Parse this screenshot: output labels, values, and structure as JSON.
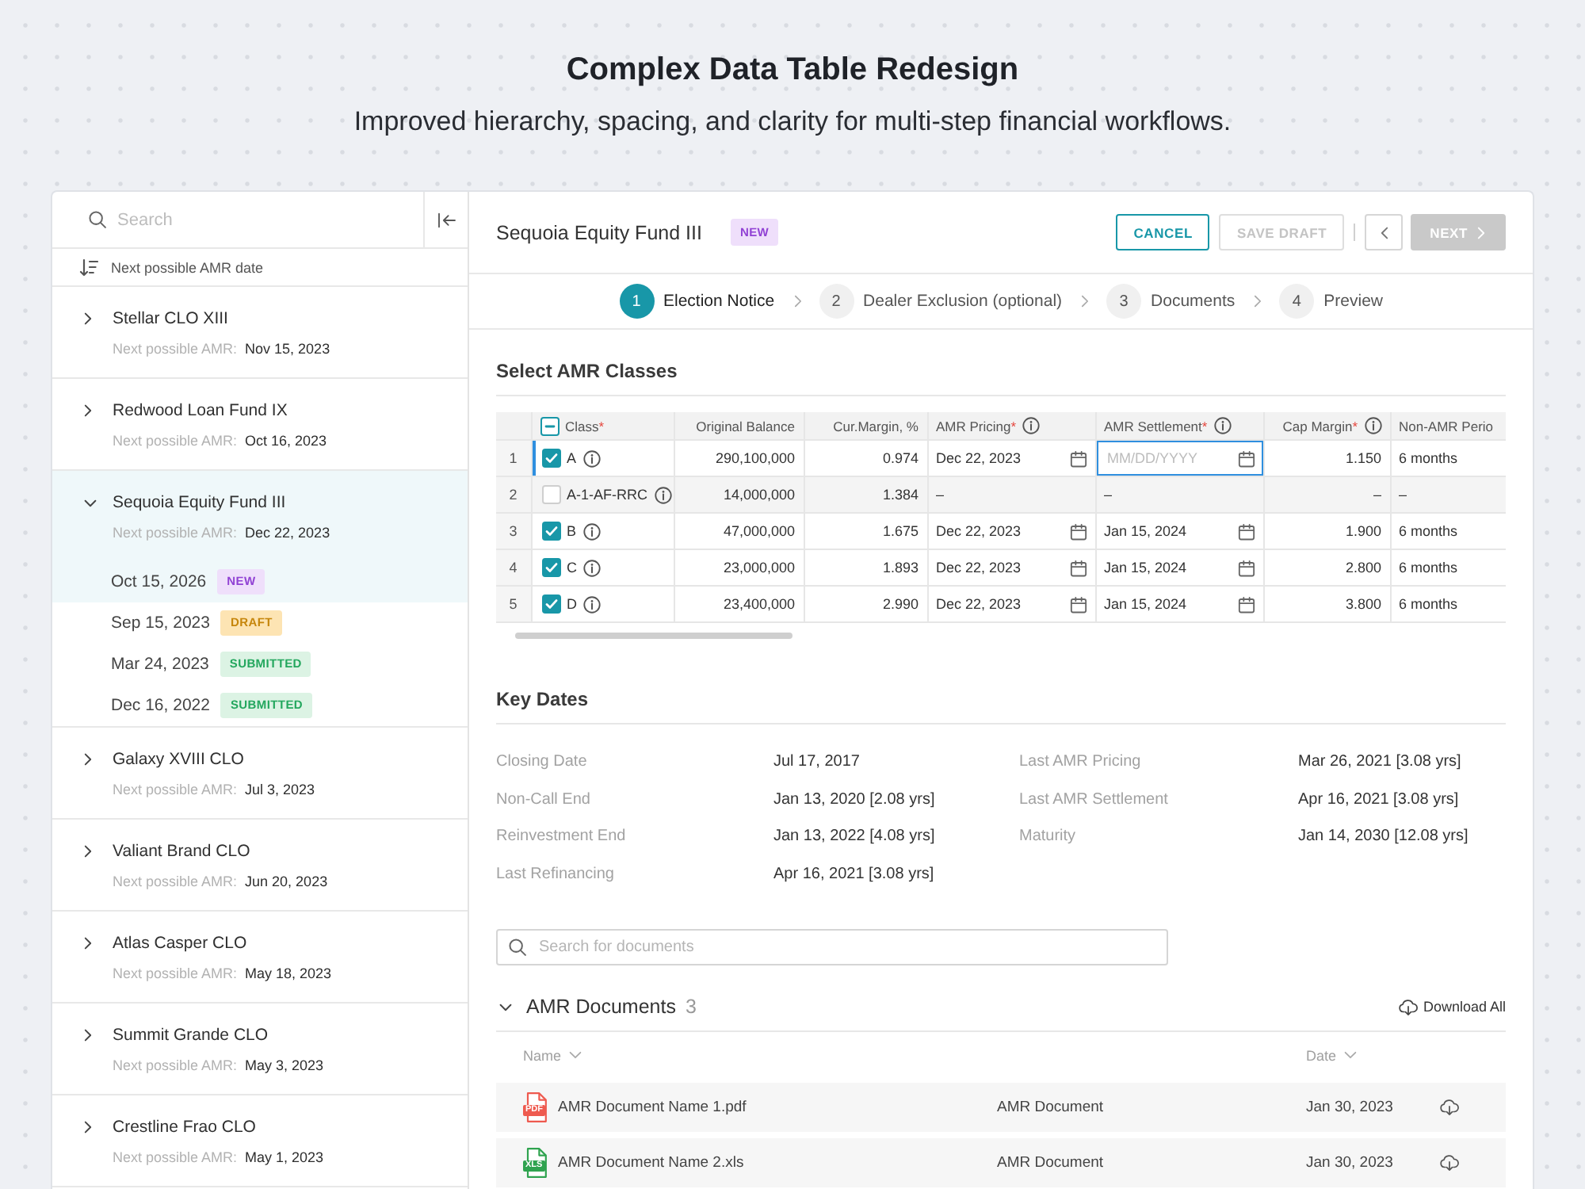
{
  "header": {
    "title": "Complex Data Table Redesign",
    "subtitle": "Improved hierarchy, spacing, and clarity for multi-step financial workflows."
  },
  "sidebar": {
    "search": {
      "placeholder": "Search"
    },
    "sort_label": "Next possible AMR date",
    "funds": [
      {
        "name": "Stellar CLO XIII",
        "next_label": "Next possible AMR:",
        "next_date": "Nov 15, 2023",
        "expanded": false,
        "selected": false
      },
      {
        "name": "Redwood Loan Fund IX",
        "next_label": "Next possible AMR:",
        "next_date": "Oct 16, 2023",
        "expanded": false,
        "selected": false
      },
      {
        "name": "Sequoia Equity Fund III",
        "next_label": "Next possible AMR:",
        "next_date": "Dec 22, 2023",
        "expanded": true,
        "selected": true,
        "versions": [
          {
            "date": "Oct 15, 2026",
            "status": "NEW",
            "kind": "new",
            "selected": true
          },
          {
            "date": "Sep 15, 2023",
            "status": "DRAFT",
            "kind": "draft",
            "selected": false
          },
          {
            "date": "Mar 24, 2023",
            "status": "SUBMITTED",
            "kind": "submitted",
            "selected": false
          },
          {
            "date": "Dec 16, 2022",
            "status": "SUBMITTED",
            "kind": "submitted",
            "selected": false
          }
        ]
      },
      {
        "name": "Galaxy XVIII CLO",
        "next_label": "Next possible AMR:",
        "next_date": "Jul 3, 2023",
        "expanded": false,
        "selected": false
      },
      {
        "name": "Valiant Brand CLO",
        "next_label": "Next possible AMR:",
        "next_date": "Jun 20, 2023",
        "expanded": false,
        "selected": false
      },
      {
        "name": "Atlas Casper CLO",
        "next_label": "Next possible AMR:",
        "next_date": "May 18, 2023",
        "expanded": false,
        "selected": false
      },
      {
        "name": "Summit Grande CLO",
        "next_label": "Next possible AMR:",
        "next_date": "May 3, 2023",
        "expanded": false,
        "selected": false
      },
      {
        "name": "Crestline Frao CLO",
        "next_label": "Next possible AMR:",
        "next_date": "May 1, 2023",
        "expanded": false,
        "selected": false
      }
    ]
  },
  "fund": {
    "title": "Sequoia Equity Fund III",
    "badge": {
      "label": "NEW",
      "kind": "new"
    },
    "actions": [
      {
        "kind": "cancel",
        "label": "CANCEL",
        "disabled": false
      },
      {
        "kind": "save",
        "label": "SAVE DRAFT",
        "disabled": true
      },
      {
        "kind": "back",
        "disabled": false
      },
      {
        "kind": "next",
        "label": "NEXT",
        "disabled": true
      }
    ],
    "steps": [
      {
        "number": "1",
        "label": "Election Notice",
        "selected": true
      },
      {
        "number": "2",
        "label": "Dealer Exclusion (optional)",
        "selected": false
      },
      {
        "number": "3",
        "label": "Documents",
        "selected": false
      },
      {
        "number": "4",
        "label": "Preview",
        "selected": false
      }
    ]
  },
  "classes": {
    "title": "Select AMR Classes",
    "select_all": {
      "checked": false,
      "partial": true
    },
    "columns": [
      {
        "label": "Class",
        "required_mark": "*",
        "info": false,
        "kind": "class"
      },
      {
        "label": "Original Balance",
        "info": false,
        "kind": "number"
      },
      {
        "label": "Cur.Margin, %",
        "info": false,
        "kind": "number"
      },
      {
        "label": "AMR Pricing",
        "required_mark": "*",
        "info": true,
        "kind": "date"
      },
      {
        "label": "AMR Settlement",
        "required_mark": "*",
        "info": true,
        "kind": "date"
      },
      {
        "label": "Cap Margin",
        "required_mark": "*",
        "info": true,
        "kind": "number"
      },
      {
        "label": "Non-AMR Perio",
        "info": false,
        "kind": "text"
      }
    ],
    "rows": [
      {
        "number": "1",
        "checked": true,
        "active": true,
        "cells": [
          "A",
          "290,100,000",
          "0.974",
          "Dec 22, 2023",
          {
            "placeholder": "MM/DD/YYYY"
          },
          "1.150",
          "6 months"
        ]
      },
      {
        "number": "2",
        "checked": false,
        "active": false,
        "cells": [
          "A-1-AF-RRC",
          "14,000,000",
          "1.384",
          "–",
          "–",
          "–",
          "–"
        ]
      },
      {
        "number": "3",
        "checked": true,
        "active": false,
        "cells": [
          "B",
          "47,000,000",
          "1.675",
          "Dec 22, 2023",
          "Jan 15, 2024",
          "1.900",
          "6 months"
        ]
      },
      {
        "number": "4",
        "checked": true,
        "active": false,
        "cells": [
          "C",
          "23,000,000",
          "1.893",
          "Dec 22, 2023",
          "Jan 15, 2024",
          "2.800",
          "6 months"
        ]
      },
      {
        "number": "5",
        "checked": true,
        "active": false,
        "cells": [
          "D",
          "23,400,000",
          "2.990",
          "Dec 22, 2023",
          "Jan 15, 2024",
          "3.800",
          "6 months"
        ]
      }
    ]
  },
  "key_dates": {
    "title": "Key Dates",
    "items": [
      {
        "label": "Closing Date",
        "value": "Jul 17, 2017"
      },
      {
        "label": "Last AMR Pricing",
        "value": "Mar 26, 2021 [3.08 yrs]"
      },
      {
        "label": "Non-Call End",
        "value": "Jan 13, 2020 [2.08 yrs]"
      },
      {
        "label": "Last AMR Settlement",
        "value": "Apr 16, 2021 [3.08 yrs]"
      },
      {
        "label": "Reinvestment End",
        "value": "Jan 13, 2022 [4.08 yrs]"
      },
      {
        "label": "Maturity",
        "value": "Jan 14, 2030 [12.08 yrs]"
      },
      {
        "label": "Last Refinancing",
        "value": "Apr 16, 2021 [3.08 yrs]"
      }
    ]
  },
  "documents": {
    "search": {
      "placeholder": "Search for documents"
    },
    "title": "AMR Documents",
    "count": "3",
    "expanded": true,
    "download_all": "Download All",
    "columns": [
      {
        "label": "Name"
      },
      {
        "label": "Date"
      }
    ],
    "rows": [
      {
        "kind": "pdf",
        "file_tag": "PDF",
        "name": "AMR Document Name 1.pdf",
        "type": "AMR Document",
        "date": "Jan 30, 2023"
      },
      {
        "kind": "xls",
        "file_tag": "XLS",
        "name": "AMR Document Name 2.xls",
        "type": "AMR Document",
        "date": "Jan 30, 2023"
      }
    ]
  }
}
